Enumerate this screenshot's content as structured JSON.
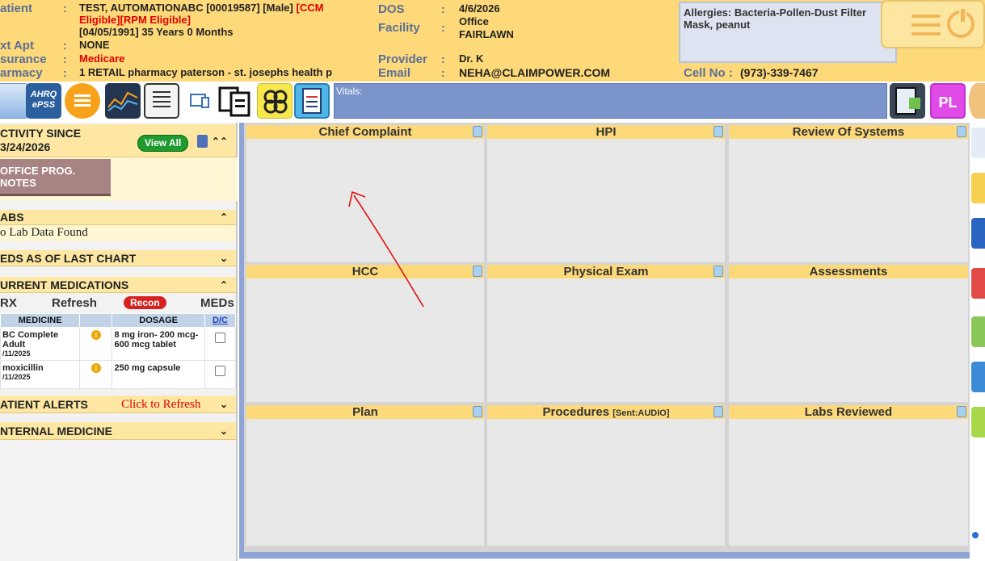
{
  "header": {
    "patient_label": "atient",
    "patient_name": "TEST, AUTOMATIONABC [00019587] [Male]",
    "patient_flags_line1": "[CCM",
    "patient_flags_line2": "Eligible][RPM Eligible]",
    "patient_dob": "[04/05/1991] 35 Years 0 Months",
    "next_appt_label": "xt Apt",
    "next_appt_value": "NONE",
    "insurance_label": "surance",
    "insurance_value": "Medicare",
    "pharmacy_label": "armacy",
    "pharmacy_value": "1 RETAIL pharmacy paterson - st. josephs health p",
    "dos_label": "DOS",
    "dos_value": "4/6/2026",
    "facility_label": "Facility",
    "facility_value_line1": "Office",
    "facility_value_line2": "FAIRLAWN",
    "provider_label": "Provider",
    "provider_value": "Dr. K",
    "email_label": "Email",
    "email_value": "NEHA@CLAIMPOWER.COM",
    "allergies": "Allergies: Bacteria-Pollen-Dust Filter Mask, peanut",
    "cell_label": "Cell No :",
    "cell_value": "(973)-339-7467",
    "colon": ":"
  },
  "toolbar": {
    "vitals_label": "Vitals:",
    "icons": [
      "notes-icon",
      "ahrq-epss-icon",
      "chat-bubble-icon",
      "trend-chart-icon",
      "document-list-icon",
      "device-icon",
      "copy-documents-icon",
      "pattern-icon",
      "clinical-form-icon",
      "clipboard-pencil-icon",
      "pl-icon",
      "avatar-icon"
    ],
    "ahrq_line1": "AHRQ",
    "ahrq_line2": "ePSS",
    "pl_label": "PL"
  },
  "sidebar": {
    "activity_line1": "CTIVITY SINCE",
    "activity_line2": "3/24/2026",
    "view_all": "View All",
    "office_notes": "OFFICE PROG. NOTES",
    "labs_title": "ABS",
    "labs_empty": "o Lab Data Found",
    "meds_last_chart": "EDS AS OF LAST CHART",
    "current_meds": "URRENT MEDICATIONS",
    "rx_label": "RX",
    "refresh_label": "Refresh",
    "recon_label": "Recon",
    "meds_label": "MEDs",
    "med_columns": [
      "MEDICINE",
      "",
      "DOSAGE",
      "D/C"
    ],
    "medications": [
      {
        "name": "BC Complete Adult",
        "date": "/11/2025",
        "dosage": "8 mg iron- 200 mcg- 600 mcg tablet"
      },
      {
        "name": "moxicillin",
        "date": "/11/2025",
        "dosage": "250 mg capsule"
      }
    ],
    "alerts_title": "ATIENT ALERTS",
    "alerts_refresh": "Click to Refresh",
    "internal_medicine": "NTERNAL MEDICINE"
  },
  "panels": {
    "chief_complaint": "Chief Complaint",
    "hpi": "HPI",
    "ros": "Review Of Systems",
    "hcc": "HCC",
    "physical_exam": "Physical Exam",
    "assessments": "Assessments",
    "plan": "Plan",
    "procedures": "Procedures",
    "procedures_sent": "[Sent:AUDIO]",
    "labs_reviewed": "Labs Reviewed"
  },
  "colors": {
    "header_bg": "#fdd97a",
    "label_blue": "#5b6f95",
    "alert_red": "#e00000",
    "vitals_bg": "#7b94cb",
    "panel_head": "#fdd97a"
  }
}
